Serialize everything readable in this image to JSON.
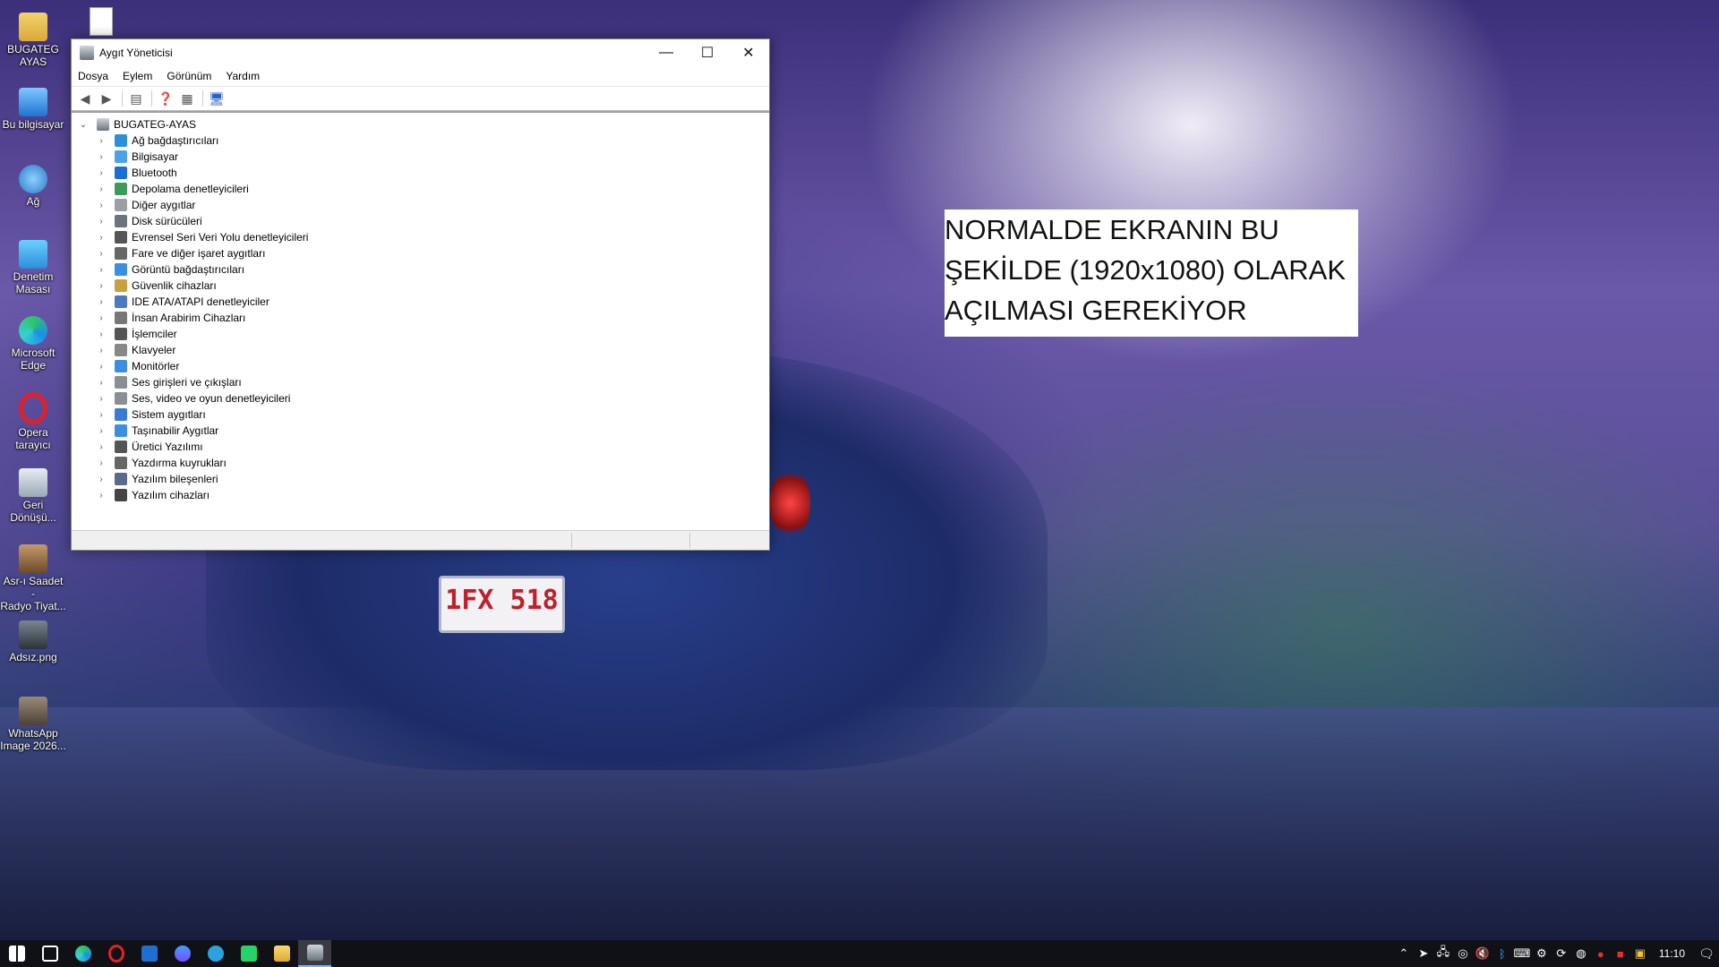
{
  "desktop": {
    "icons": [
      {
        "label": "BUGATEG\nAYAS",
        "icon": "folder-user-icon"
      },
      {
        "label": "Bu bilgisayar",
        "icon": "computer-icon"
      },
      {
        "label": "Ağ",
        "icon": "network-icon"
      },
      {
        "label": "Denetim\nMasası",
        "icon": "control-panel-icon"
      },
      {
        "label": "Microsoft\nEdge",
        "icon": "edge-icon"
      },
      {
        "label": "Opera\ntarayıcı",
        "icon": "opera-icon"
      },
      {
        "label": "Geri\nDönüşü...",
        "icon": "recycle-bin-icon"
      },
      {
        "label": "Asr-ı Saadet -\nRadyo Tiyat...",
        "icon": "app-icon"
      },
      {
        "label": "Adsız.png",
        "icon": "image-file-icon"
      },
      {
        "label": "WhatsApp\nImage 2026...",
        "icon": "image-file-icon"
      }
    ],
    "note_text": "NORMALDE EKRANIN BU ŞEKİLDE (1920x1080) OLARAK AÇILMASI GEREKİYOR",
    "note_lines": [
      "NORMALDE EKRANIN BU",
      "ŞEKİLDE (1920x1080) OLARAK",
      "AÇILMASI GEREKİYOR"
    ],
    "plate_text": "1FX 518"
  },
  "window": {
    "title": "Aygıt Yöneticisi",
    "controls": {
      "minimize": "—",
      "maximize": "☐",
      "close": "✕"
    },
    "menu": [
      "Dosya",
      "Eylem",
      "Görünüm",
      "Yardım"
    ],
    "tree": {
      "root": "BUGATEG-AYAS",
      "items": [
        "Ağ bağdaştırıcıları",
        "Bilgisayar",
        "Bluetooth",
        "Depolama denetleyicileri",
        "Diğer aygıtlar",
        "Disk sürücüleri",
        "Evrensel Seri Veri Yolu denetleyicileri",
        "Fare ve diğer işaret aygıtları",
        "Görüntü bağdaştırıcıları",
        "Güvenlik cihazları",
        "IDE ATA/ATAPI denetleyiciler",
        "İnsan Arabirim Cihazları",
        "İşlemciler",
        "Klavyeler",
        "Monitörler",
        "Ses girişleri ve çıkışları",
        "Ses, video ve oyun denetleyicileri",
        "Sistem aygıtları",
        "Taşınabilir Aygıtlar",
        "Üretici Yazılımı",
        "Yazdırma kuyrukları",
        "Yazılım bileşenleri",
        "Yazılım cihazları"
      ]
    }
  },
  "taskbar": {
    "clock": "11:10",
    "colors": {
      "background": "#101116",
      "accent": "#7ab4ff"
    }
  }
}
